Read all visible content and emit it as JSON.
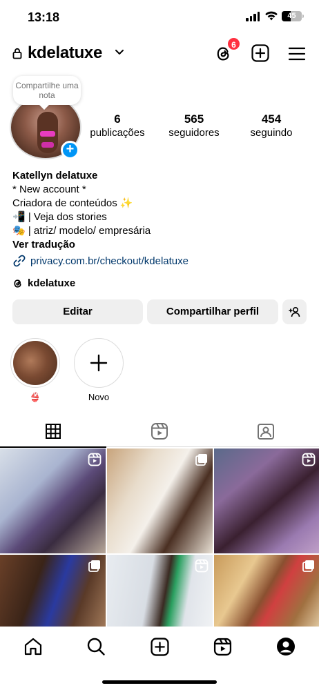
{
  "status_bar": {
    "time": "13:18",
    "battery": "45",
    "battery_fraction": 0.45
  },
  "header": {
    "username": "kdelatuxe",
    "threads_badge": "6"
  },
  "profile": {
    "note_prompt": "Compartilhe uma nota",
    "stats": [
      {
        "value": "6",
        "label": "publicações"
      },
      {
        "value": "565",
        "label": "seguidores"
      },
      {
        "value": "454",
        "label": "seguindo"
      }
    ],
    "name": "Katellyn delatuxe",
    "bio_lines": [
      "* New account *",
      "Criadora de conteúdos ✨",
      "📲 | Veja dos stories",
      "🎭 | atriz/ modelo/ empresária"
    ],
    "translate": "Ver tradução",
    "link": "privacy.com.br/checkout/kdelatuxe",
    "threads_handle": "kdelatuxe"
  },
  "actions": {
    "edit": "Editar",
    "share": "Compartilhar perfil"
  },
  "highlights": [
    {
      "label": "👙"
    },
    {
      "label": "Novo"
    }
  ],
  "tabs": [
    "posts-grid",
    "reels",
    "tagged"
  ],
  "colors": {
    "accent": "#0095f6",
    "badge": "#ff3040",
    "link": "#00376b",
    "button_bg": "#efefef",
    "divider": "#dbdbdb"
  }
}
